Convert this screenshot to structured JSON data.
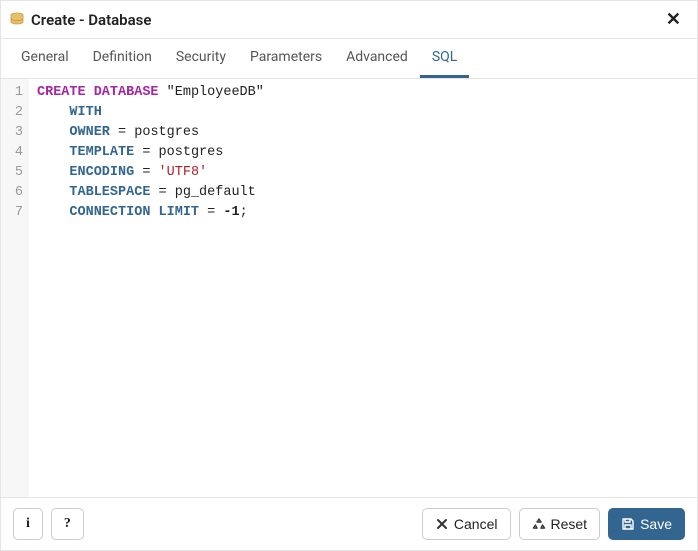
{
  "header": {
    "title": "Create - Database"
  },
  "tabs": [
    {
      "label": "General",
      "active": false
    },
    {
      "label": "Definition",
      "active": false
    },
    {
      "label": "Security",
      "active": false
    },
    {
      "label": "Parameters",
      "active": false
    },
    {
      "label": "Advanced",
      "active": false
    },
    {
      "label": "SQL",
      "active": true
    }
  ],
  "sql": {
    "lines": [
      [
        {
          "t": "CREATE DATABASE",
          "c": "tok-kw"
        },
        {
          "t": " ",
          "c": ""
        },
        {
          "t": "\"EmployeeDB\"",
          "c": "tok-qident"
        }
      ],
      [
        {
          "t": "    ",
          "c": ""
        },
        {
          "t": "WITH",
          "c": "tok-kw2"
        }
      ],
      [
        {
          "t": "    ",
          "c": ""
        },
        {
          "t": "OWNER",
          "c": "tok-kw2"
        },
        {
          "t": " ",
          "c": ""
        },
        {
          "t": "=",
          "c": "tok-op"
        },
        {
          "t": " postgres",
          "c": "tok-ident"
        }
      ],
      [
        {
          "t": "    ",
          "c": ""
        },
        {
          "t": "TEMPLATE",
          "c": "tok-kw2"
        },
        {
          "t": " ",
          "c": ""
        },
        {
          "t": "=",
          "c": "tok-op"
        },
        {
          "t": " postgres",
          "c": "tok-ident"
        }
      ],
      [
        {
          "t": "    ",
          "c": ""
        },
        {
          "t": "ENCODING",
          "c": "tok-kw2"
        },
        {
          "t": " ",
          "c": ""
        },
        {
          "t": "=",
          "c": "tok-op"
        },
        {
          "t": " ",
          "c": ""
        },
        {
          "t": "'UTF8'",
          "c": "tok-str"
        }
      ],
      [
        {
          "t": "    ",
          "c": ""
        },
        {
          "t": "TABLESPACE",
          "c": "tok-kw2"
        },
        {
          "t": " ",
          "c": ""
        },
        {
          "t": "=",
          "c": "tok-op"
        },
        {
          "t": " pg_default",
          "c": "tok-ident"
        }
      ],
      [
        {
          "t": "    ",
          "c": ""
        },
        {
          "t": "CONNECTION LIMIT",
          "c": "tok-kw2"
        },
        {
          "t": " ",
          "c": ""
        },
        {
          "t": "=",
          "c": "tok-op"
        },
        {
          "t": " ",
          "c": ""
        },
        {
          "t": "-1",
          "c": "tok-num"
        },
        {
          "t": ";",
          "c": "tok-op"
        }
      ]
    ]
  },
  "footer": {
    "info_label": "i",
    "help_label": "?",
    "cancel_label": "Cancel",
    "reset_label": "Reset",
    "save_label": "Save"
  }
}
